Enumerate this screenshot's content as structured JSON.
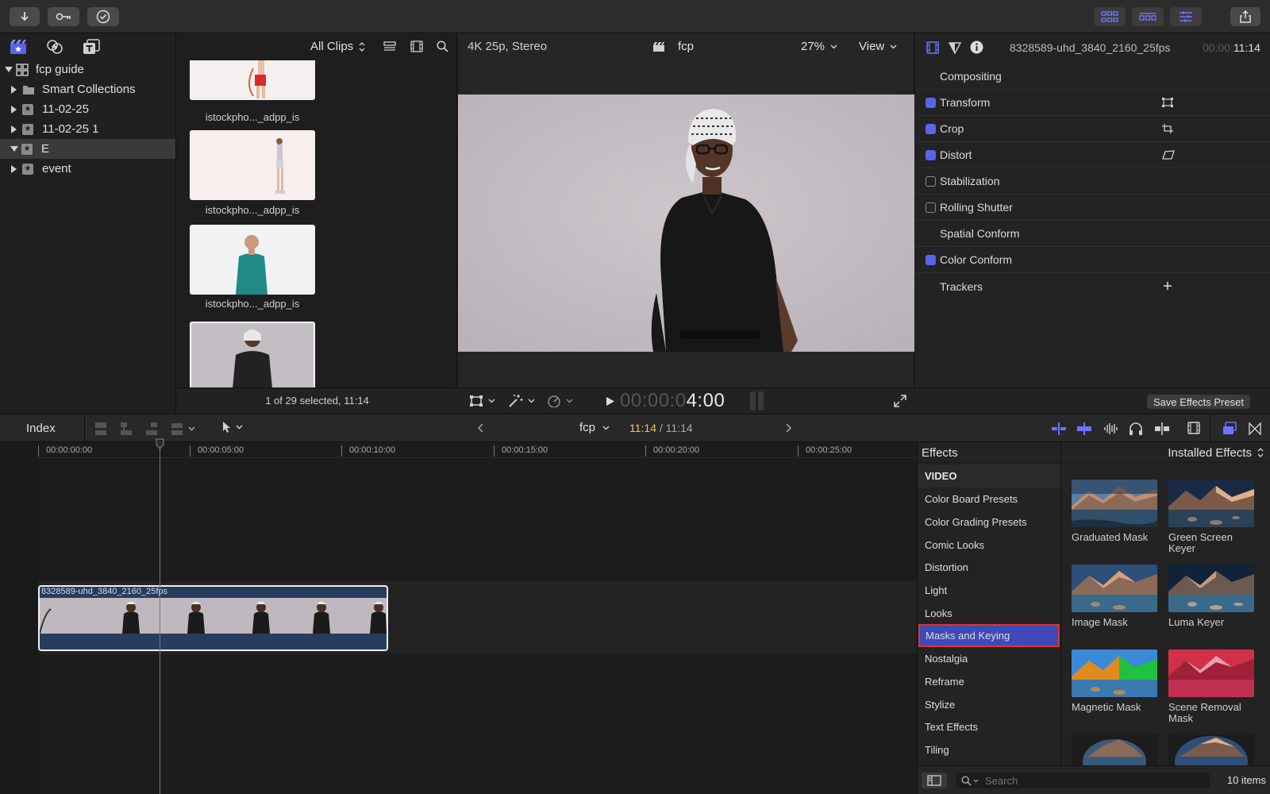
{
  "library": {
    "rows": [
      {
        "label": "fcp guide",
        "expanded": true
      },
      {
        "label": "Smart Collections"
      },
      {
        "label": "11-02-25"
      },
      {
        "label": "11-02-25 1"
      },
      {
        "label": "E",
        "selected": true
      },
      {
        "label": "event"
      }
    ]
  },
  "browser": {
    "filter_label": "All Clips",
    "clips": [
      {
        "label": "istockpho..._adpp_is"
      },
      {
        "label": "istockpho..._adpp_is"
      },
      {
        "label": "istockpho..._adpp_is"
      },
      {
        "label": ""
      }
    ],
    "status": "1 of 29 selected, 11:14"
  },
  "viewer": {
    "format": "4K 25p, Stereo",
    "project": "fcp",
    "zoom": "27%",
    "view_label": "View",
    "timecode_dim": "00:00:0",
    "timecode_bright": "4:00"
  },
  "inspector": {
    "clip_name": "8328589-uhd_3840_2160_25fps",
    "duration_dim": "00:00:",
    "duration": "11:14",
    "rows": [
      {
        "label": "Compositing",
        "checkbox": "none"
      },
      {
        "label": "Transform",
        "checkbox": "on"
      },
      {
        "label": "Crop",
        "checkbox": "on"
      },
      {
        "label": "Distort",
        "checkbox": "on"
      },
      {
        "label": "Stabilization",
        "checkbox": "off"
      },
      {
        "label": "Rolling Shutter",
        "checkbox": "off"
      },
      {
        "label": "Spatial Conform",
        "checkbox": "none"
      },
      {
        "label": "Color Conform",
        "checkbox": "on"
      },
      {
        "label": "Trackers",
        "checkbox": "none"
      }
    ],
    "save_preset": "Save Effects Preset"
  },
  "timeline": {
    "index_label": "Index",
    "project": "fcp",
    "position": "11:14",
    "separator": " / ",
    "total": "11:14",
    "ruler": [
      "00:00:00:00",
      "00:00:05:00",
      "00:00:10:00",
      "00:00:15:00",
      "00:00:20:00",
      "00:00:25:00"
    ],
    "clip_name": "8328589-uhd_3840_2160_25fps"
  },
  "effects": {
    "title": "Effects",
    "installed": "Installed Effects",
    "heading": "VIDEO",
    "categories": [
      "Color Board Presets",
      "Color Grading Presets",
      "Comic Looks",
      "Distortion",
      "Light",
      "Looks",
      "Masks and Keying",
      "Nostalgia",
      "Reframe",
      "Stylize",
      "Text Effects",
      "Tiling"
    ],
    "selected_category": "Masks and Keying",
    "tiles": [
      {
        "name": "Graduated Mask"
      },
      {
        "name": "Green Screen Keyer"
      },
      {
        "name": "Image Mask"
      },
      {
        "name": "Luma Keyer"
      },
      {
        "name": "Magnetic Mask"
      },
      {
        "name": "Scene Removal Mask"
      }
    ],
    "search_placeholder": "Search",
    "count": "10 items"
  },
  "colors": {
    "accent": "#5b63e8",
    "timecode_yellow": "#e9c46a",
    "highlight_red": "#e0332b",
    "clip_blue": "#273d5e"
  }
}
